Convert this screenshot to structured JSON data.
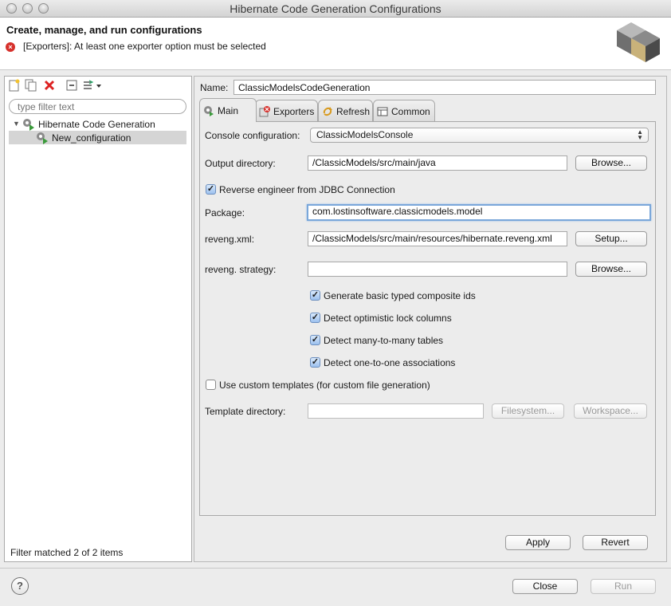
{
  "window": {
    "title": "Hibernate Code Generation Configurations"
  },
  "banner": {
    "title": "Create, manage, and run configurations",
    "error_message": "[Exporters]: At least one exporter option must be selected"
  },
  "left_panel": {
    "filter_placeholder": "type filter text",
    "tree": {
      "category": "Hibernate Code Generation",
      "child": "New_configuration"
    },
    "status": "Filter matched 2 of 2 items"
  },
  "config": {
    "name_label": "Name:",
    "name_value": "ClassicModelsCodeGeneration",
    "tabs": [
      {
        "label": "Main",
        "icon": "main-tab-icon"
      },
      {
        "label": "Exporters",
        "icon": "exporters-error-icon"
      },
      {
        "label": "Refresh",
        "icon": "refresh-icon"
      },
      {
        "label": "Common",
        "icon": "common-table-icon"
      }
    ],
    "active_tab": "Main"
  },
  "main_tab": {
    "console_label": "Console configuration:",
    "console_value": "ClassicModelsConsole",
    "output_label": "Output directory:",
    "output_value": "/ClassicModels/src/main/java",
    "browse_label": "Browse...",
    "reverse_engineer_label": "Reverse engineer from JDBC Connection",
    "reverse_engineer_checked": true,
    "package_label": "Package:",
    "package_value": "com.lostinsoftware.classicmodels.model",
    "reveng_xml_label": "reveng.xml:",
    "reveng_xml_value": "/ClassicModels/src/main/resources/hibernate.reveng.xml",
    "setup_label": "Setup...",
    "reveng_strategy_label": "reveng. strategy:",
    "reveng_strategy_value": "",
    "browse2_label": "Browse...",
    "options": [
      {
        "label": "Generate basic typed composite ids",
        "checked": true
      },
      {
        "label": "Detect optimistic lock columns",
        "checked": true
      },
      {
        "label": "Detect many-to-many tables",
        "checked": true
      },
      {
        "label": "Detect one-to-one associations",
        "checked": true
      }
    ],
    "custom_templates_label": "Use custom templates (for custom file generation)",
    "custom_templates_checked": false,
    "template_dir_label": "Template directory:",
    "template_dir_value": "",
    "filesystem_label": "Filesystem...",
    "workspace_label": "Workspace..."
  },
  "actions": {
    "apply": "Apply",
    "revert": "Revert",
    "close": "Close",
    "run": "Run",
    "help": "?"
  },
  "colors": {
    "error": "#d6302b",
    "focus": "#7aa7da",
    "selection": "#d5d5d5"
  }
}
